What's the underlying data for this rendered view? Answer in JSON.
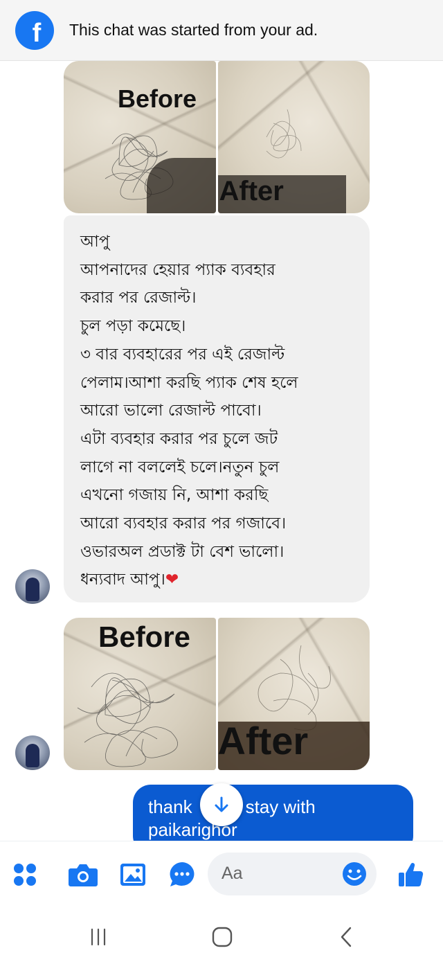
{
  "banner": {
    "text": "This chat was started from your ad."
  },
  "photos": {
    "before_label": "Before",
    "after_label": "After"
  },
  "message": {
    "lines": [
      "আপু",
      "আপনাদের হেয়ার প্যাক ব্যবহার",
      "করার পর রেজাল্ট।",
      "চুল পড়া কমেছে।",
      "৩ বার ব্যবহারের পর এই রেজাল্ট",
      "পেলাম।আশা করছি প্যাক শেষ হলে",
      "আরো ভালো রেজাল্ট পাবো।",
      "এটা ব্যবহার করার পর চুলে জট",
      "লাগে না বললেই চলে।নতুন চুল",
      "এখনো গজায় নি, আশা করছি",
      "আরো ব্যবহার করার পর গজাবে।",
      "ওভারঅল প্রডাক্ট টা বেশ ভালো।",
      "ধন্যবাদ আপু।"
    ],
    "emoji": "❤"
  },
  "outgoing": {
    "line1a": "thank",
    "line1b": "stay with",
    "line2": "paikarighor"
  },
  "composer": {
    "placeholder": "Aa",
    "icons": [
      "apps-icon",
      "camera-icon",
      "gallery-icon",
      "chat-bubble-icon",
      "emoji-icon",
      "thumbs-up-icon"
    ]
  },
  "navigation": {
    "icons": [
      "recent-apps-icon",
      "home-icon",
      "back-icon"
    ]
  },
  "colors": {
    "accent": "#0b5bd1",
    "messenger_blue": "#1877f2",
    "heart": "#e0242c"
  }
}
